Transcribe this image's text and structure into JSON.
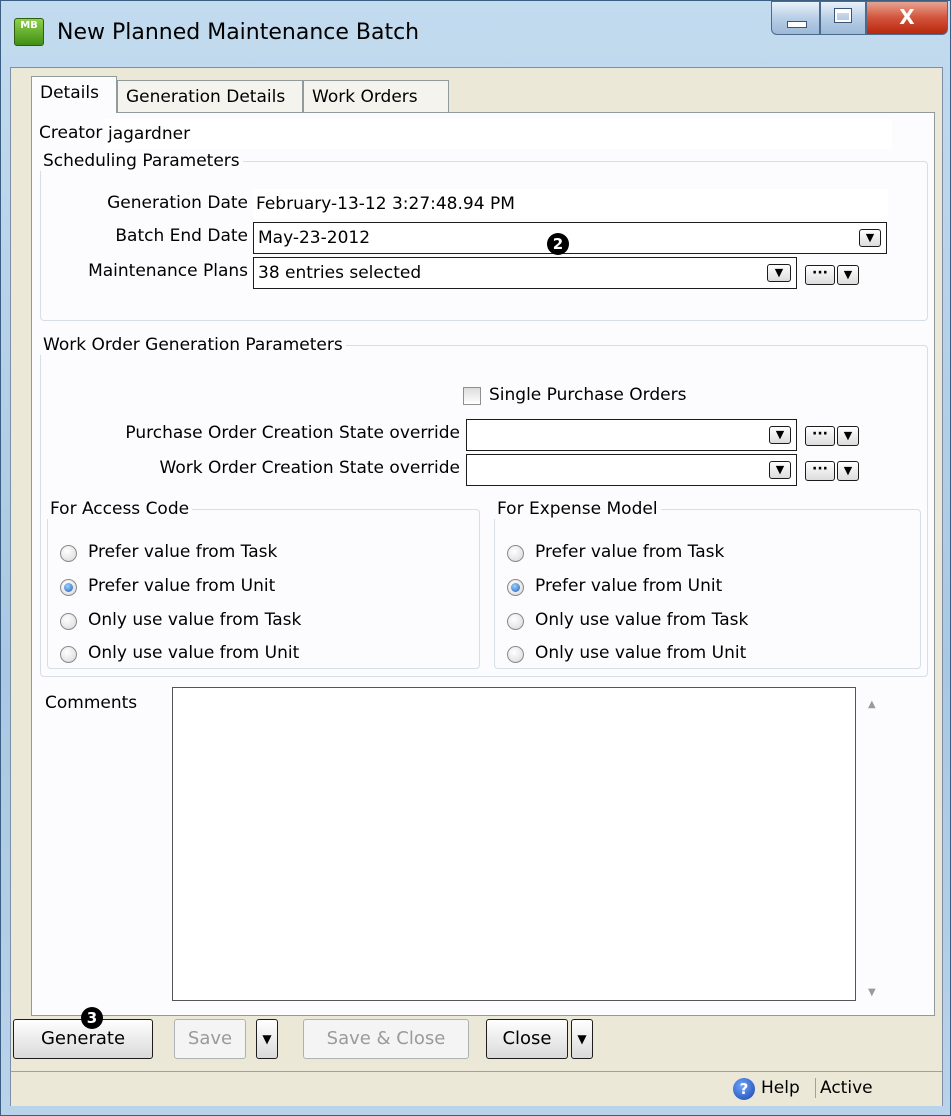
{
  "window": {
    "title": "New Planned Maintenance Batch",
    "app_icon_text": "MB",
    "close_glyph": "X"
  },
  "tabs": [
    {
      "label": "Details"
    },
    {
      "label": "Generation Details"
    },
    {
      "label": "Work Orders"
    }
  ],
  "creator": {
    "label": "Creator",
    "value": "jagardner"
  },
  "scheduling": {
    "legend": "Scheduling Parameters",
    "generation_date_label": "Generation Date",
    "generation_date_value": "February-13-12 3:27:48.94 PM",
    "batch_end_date_label": "Batch End Date",
    "batch_end_date_value": "May-23-2012",
    "maintenance_plans_label": "Maintenance Plans",
    "maintenance_plans_value": "38 entries selected"
  },
  "work_order_generation": {
    "legend": "Work Order Generation Parameters",
    "single_po_label": "Single Purchase Orders",
    "po_state_label": "Purchase Order Creation State override",
    "po_state_value": "",
    "wo_state_label": "Work Order Creation State override",
    "wo_state_value": ""
  },
  "access_code": {
    "legend": "For Access Code",
    "options": [
      "Prefer value from Task",
      "Prefer value from Unit",
      "Only use value from Task",
      "Only use value from Unit"
    ],
    "selected": "Prefer value from Unit"
  },
  "expense_model": {
    "legend": "For Expense Model",
    "options": [
      "Prefer value from Task",
      "Prefer value from Unit",
      "Only use value from Task",
      "Only use value from Unit"
    ],
    "selected": "Prefer value from Unit"
  },
  "comments": {
    "label": "Comments",
    "value": ""
  },
  "buttons": {
    "generate": "Generate",
    "save": "Save",
    "save_close": "Save & Close",
    "close": "Close",
    "ellipsis": "···"
  },
  "callouts": {
    "batch_end": "2",
    "generate": "3"
  },
  "status": {
    "help": "Help",
    "state": "Active"
  }
}
